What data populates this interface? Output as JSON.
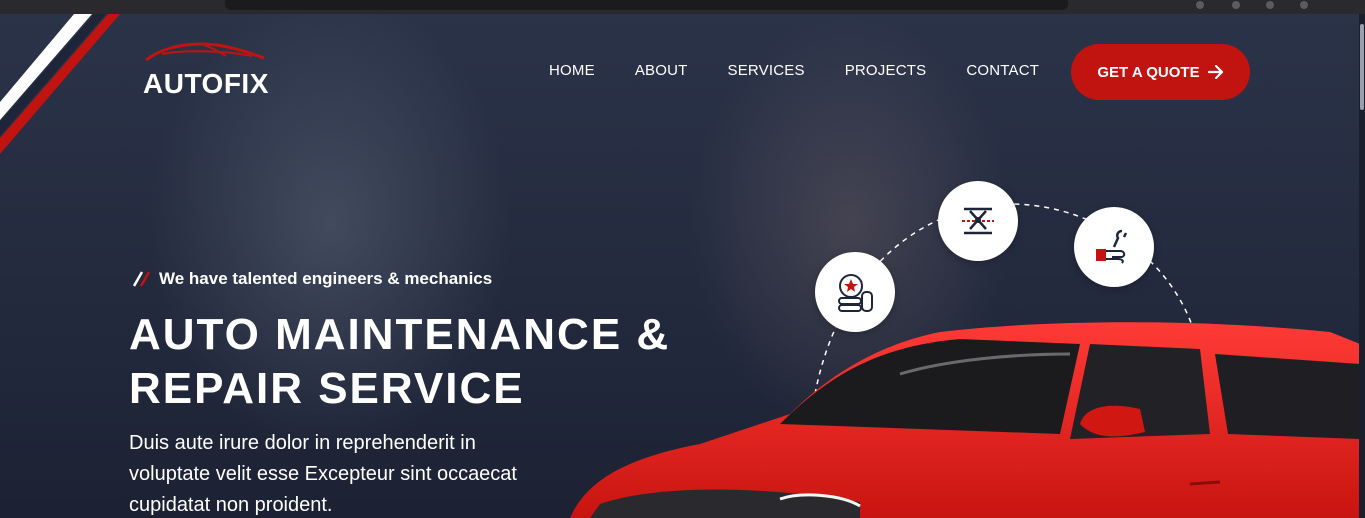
{
  "brand": {
    "name": "AUTOFIX",
    "accent": "#c1130f"
  },
  "nav": {
    "items": [
      {
        "label": "HOME"
      },
      {
        "label": "ABOUT"
      },
      {
        "label": "SERVICES"
      },
      {
        "label": "PROJECTS"
      },
      {
        "label": "CONTACT"
      }
    ],
    "cta_label": "GET A QUOTE",
    "cta_icon": "arrow-right-icon"
  },
  "hero": {
    "tagline": "We have talented engineers & mechanics",
    "title_line1": "AUTO MAINTENANCE &",
    "title_line2": "REPAIR SERVICE",
    "description": "Duis aute irure dolor in reprehenderit in voluptate velit esse Excepteur sint occaecat cupidatat non proident.",
    "service_icons": [
      "tire-icon",
      "car-jack-icon",
      "wrench-hand-icon"
    ]
  }
}
